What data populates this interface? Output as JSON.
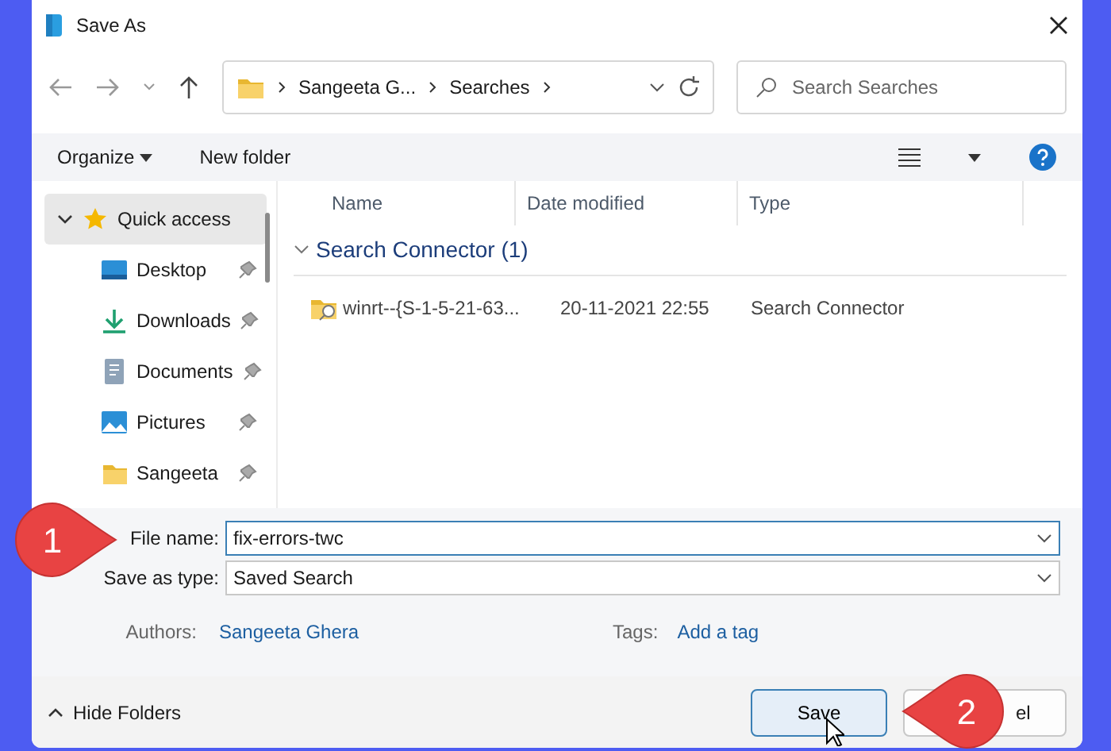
{
  "window": {
    "title": "Save As"
  },
  "navigation": {
    "breadcrumbs": [
      "Sangeeta G...",
      "Searches"
    ],
    "search_placeholder": "Search Searches"
  },
  "toolbar": {
    "organize": "Organize",
    "new_folder": "New folder"
  },
  "sidebar": {
    "items": [
      {
        "label": "Quick access",
        "kind": "star",
        "selected": true,
        "expanded": true,
        "pinned": false
      },
      {
        "label": "Desktop",
        "kind": "desktop",
        "selected": false,
        "pinned": true
      },
      {
        "label": "Downloads",
        "kind": "download",
        "selected": false,
        "pinned": true
      },
      {
        "label": "Documents",
        "kind": "document",
        "selected": false,
        "pinned": true
      },
      {
        "label": "Pictures",
        "kind": "picture",
        "selected": false,
        "pinned": true
      },
      {
        "label": "Sangeeta",
        "kind": "folder",
        "selected": false,
        "pinned": true
      }
    ]
  },
  "file_list": {
    "columns": [
      "Name",
      "Date modified",
      "Type"
    ],
    "groups": [
      {
        "label": "Search Connector (1)",
        "expanded": true,
        "rows": [
          {
            "name": "winrt--{S-1-5-21-63...",
            "date": "20-11-2021 22:55",
            "type": "Search Connector"
          }
        ]
      }
    ]
  },
  "form": {
    "file_name_label": "File name:",
    "file_name": "fix-errors-twc",
    "type_label": "Save as type:",
    "type_value": "Saved Search",
    "authors_label": "Authors:",
    "authors": "Sangeeta Ghera",
    "tags_label": "Tags:",
    "tags": "Add a tag"
  },
  "footer": {
    "hide_folders": "Hide Folders",
    "save": "Save",
    "cancel": "el"
  },
  "callouts": [
    "1",
    "2"
  ]
}
